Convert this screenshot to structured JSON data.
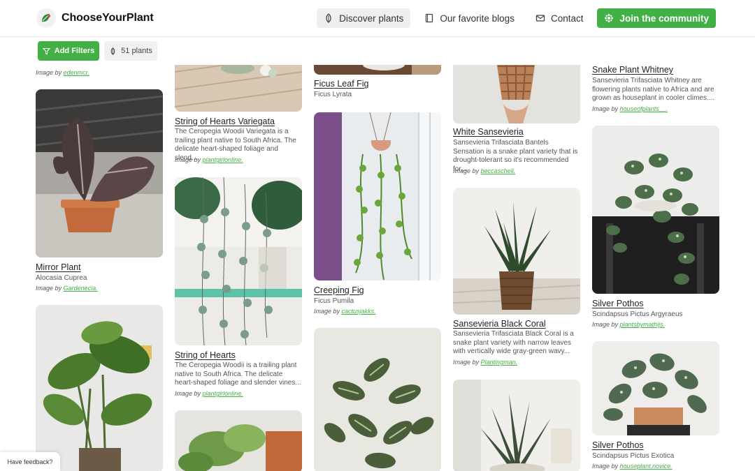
{
  "brand": {
    "name": "ChooseYourPlant"
  },
  "nav": {
    "discover": "Discover plants",
    "blogs": "Our favorite blogs",
    "contact": "Contact",
    "join": "Join the community"
  },
  "filters": {
    "add_label": "Add Filters",
    "count_label": "51 plants"
  },
  "colors": {
    "accent": "#43b046",
    "link": "#43b046"
  },
  "image_prefix": "Image by",
  "columns": [
    [
      {
        "title": "",
        "subtitle": "",
        "credit": "edenmcr."
      },
      {
        "title": "Mirror Plant",
        "subtitle": "Alocasia Cuprea",
        "credit": "Gardenecia."
      },
      {
        "title": "",
        "subtitle": "",
        "credit": ""
      }
    ],
    [
      {
        "title": "String of Hearts Variegata",
        "subtitle": "The Ceropegia Woodii Variegata is a trailing plant native to South Africa. The delicate heart-shaped foliage and slend...",
        "credit": "plantgirlonline."
      },
      {
        "title": "String of Hearts",
        "subtitle": "The Ceropegia Woodii is a trailing plant native to South Africa. The delicate heart-shaped foliage and slender vines...",
        "credit": "plantgirlonline."
      },
      {
        "title": "",
        "subtitle": "",
        "credit": ""
      }
    ],
    [
      {
        "title": "Ficus Leaf Fig",
        "subtitle": "Ficus Lyrata",
        "credit": ""
      },
      {
        "title": "Creeping Fig",
        "subtitle": "Ficus Pumila",
        "credit": "cactusjakks."
      },
      {
        "title": "",
        "subtitle": "",
        "credit": ""
      }
    ],
    [
      {
        "title": "White Sansevieria",
        "subtitle": "Sansevieria Trifasciata Bantels Sensation is a snake plant variety that is drought-tolerant so it's recommended for...",
        "credit": "beccaschell."
      },
      {
        "title": "Sansevieria Black Coral",
        "subtitle": "Sansevieria Trifasciata Black Coral is a snake plant variety with narrow leaves with vertically wide gray-green wavy...",
        "credit": "Plantingman."
      },
      {
        "title": "",
        "subtitle": "",
        "credit": ""
      }
    ],
    [
      {
        "title": "Snake Plant Whitney",
        "subtitle": "Sansevieria Trifasciata Whitney are flowering plants native to Africa and are grown as houseplant in cooler climes....",
        "credit": "houseofplants__."
      },
      {
        "title": "Silver Pothos",
        "subtitle": "Scindapsus Pictus Argyraeus",
        "credit": "plantsbymathijs."
      },
      {
        "title": "Silver Pothos",
        "subtitle": "Scindapsus Pictus Exotica",
        "credit": "houseplant.novice."
      }
    ]
  ],
  "feedback": {
    "label": "Have feedback?"
  }
}
